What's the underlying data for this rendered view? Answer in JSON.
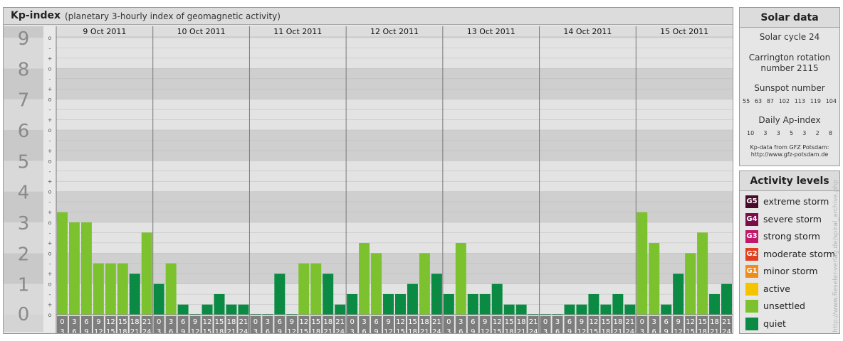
{
  "header": {
    "title": "Kp-index",
    "subtitle": "(planetary 3-hourly index of geomagnetic activity)"
  },
  "colors": {
    "quiet": "#0a8a43",
    "unsettled": "#7cc22e",
    "active": "#f5c400",
    "minor_storm": "#f08c1a",
    "moderate_storm": "#e0401f",
    "strong_storm": "#c0186b",
    "severe_storm": "#7a0d4a",
    "extreme_storm": "#4a0a2b"
  },
  "chart_data": {
    "type": "bar",
    "title": "Kp-index",
    "subtitle": "(planetary 3-hourly index of geomagnetic activity)",
    "ylim": [
      0,
      9
    ],
    "y_ticks": [
      "0",
      "1",
      "2",
      "3",
      "4",
      "5",
      "6",
      "7",
      "8",
      "9"
    ],
    "y_minor_ticks": [
      "o",
      "+",
      "-",
      "o",
      "+",
      "-",
      "o",
      "+",
      "-",
      "o",
      "+",
      "-",
      "o",
      "+",
      "-",
      "o",
      "+",
      "-",
      "o",
      "+",
      "-",
      "o",
      "+",
      "-",
      "o",
      "+",
      "-",
      "o"
    ],
    "days": [
      "9 Oct 2011",
      "10 Oct 2011",
      "11 Oct 2011",
      "12 Oct 2011",
      "13 Oct 2011",
      "14 Oct 2011",
      "15 Oct 2011"
    ],
    "interval_start": [
      "0",
      "3",
      "6",
      "9",
      "12",
      "15",
      "18",
      "21"
    ],
    "interval_end": [
      "3",
      "6",
      "9",
      "12",
      "15",
      "18",
      "21",
      "24"
    ],
    "values": [
      [
        3.33,
        3.0,
        3.0,
        1.67,
        1.67,
        1.67,
        1.33,
        2.67
      ],
      [
        1.0,
        1.67,
        0.33,
        0.0,
        0.33,
        0.67,
        0.33,
        0.33
      ],
      [
        0.0,
        0.0,
        1.33,
        0.0,
        1.67,
        1.67,
        1.33,
        0.33
      ],
      [
        0.67,
        2.33,
        2.0,
        0.67,
        0.67,
        1.0,
        2.0,
        1.33
      ],
      [
        0.67,
        2.33,
        0.67,
        0.67,
        1.0,
        0.33,
        0.33,
        0.0
      ],
      [
        0.0,
        0.0,
        0.33,
        0.33,
        0.67,
        0.33,
        0.67,
        0.33
      ],
      [
        3.33,
        2.33,
        0.33,
        1.33,
        2.0,
        2.67,
        0.67,
        1.0
      ]
    ],
    "levels": [
      [
        "unsettled",
        "unsettled",
        "unsettled",
        "unsettled",
        "unsettled",
        "unsettled",
        "quiet",
        "unsettled"
      ],
      [
        "quiet",
        "unsettled",
        "quiet",
        "quiet",
        "quiet",
        "quiet",
        "quiet",
        "quiet"
      ],
      [
        "quiet",
        "quiet",
        "quiet",
        "quiet",
        "unsettled",
        "unsettled",
        "quiet",
        "quiet"
      ],
      [
        "quiet",
        "unsettled",
        "unsettled",
        "quiet",
        "quiet",
        "quiet",
        "unsettled",
        "quiet"
      ],
      [
        "quiet",
        "unsettled",
        "quiet",
        "quiet",
        "quiet",
        "quiet",
        "quiet",
        "quiet"
      ],
      [
        "quiet",
        "quiet",
        "quiet",
        "quiet",
        "quiet",
        "quiet",
        "quiet",
        "quiet"
      ],
      [
        "unsettled",
        "unsettled",
        "quiet",
        "quiet",
        "unsettled",
        "unsettled",
        "quiet",
        "quiet"
      ]
    ],
    "grid": true
  },
  "solar": {
    "title": "Solar data",
    "cycle": "Solar cycle 24",
    "carrington_line1": "Carrington rotation",
    "carrington_line2": "number 2115",
    "sunspot_title": "Sunspot number",
    "sunspot_values": [
      "55",
      "63",
      "87",
      "102",
      "113",
      "119",
      "104"
    ],
    "ap_title": "Daily Ap-index",
    "ap_values": [
      "10",
      "3",
      "3",
      "5",
      "3",
      "2",
      "8"
    ],
    "source_line1": "Kp-data from GFZ Potsdam:",
    "source_line2": "http://www.gfz-potsdam.de"
  },
  "activity": {
    "title": "Activity levels",
    "items": [
      {
        "badge": "G5",
        "label": "extreme storm",
        "color": "#4a0a2b"
      },
      {
        "badge": "G4",
        "label": "severe storm",
        "color": "#7a0d4a"
      },
      {
        "badge": "G3",
        "label": "strong storm",
        "color": "#c0186b"
      },
      {
        "badge": "G2",
        "label": "moderate storm",
        "color": "#e0401f"
      },
      {
        "badge": "G1",
        "label": "minor storm",
        "color": "#f08c1a"
      },
      {
        "badge": "",
        "label": "active",
        "color": "#f5c400"
      },
      {
        "badge": "",
        "label": "unsettled",
        "color": "#7cc22e"
      },
      {
        "badge": "",
        "label": "quiet",
        "color": "#0a8a43"
      }
    ]
  },
  "watermark": "http://www.fieseler-verlag.de/spiral_archive.php"
}
